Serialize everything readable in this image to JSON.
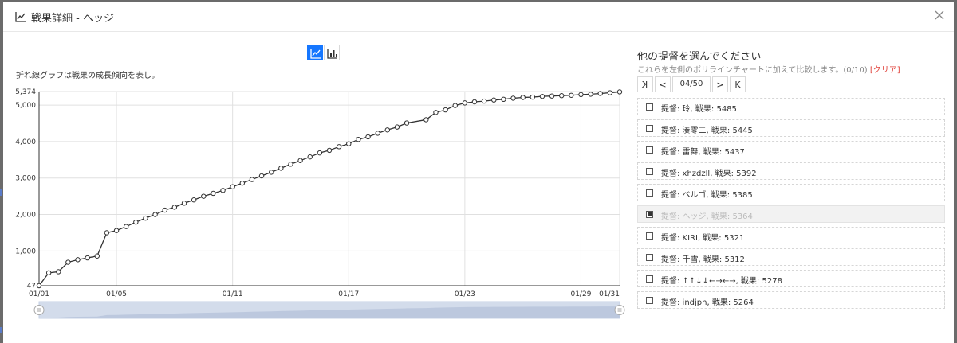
{
  "title": "戦果詳細 - ヘッジ",
  "chart_caption": "折れ線グラフは戦果の成長傾向を表し。",
  "right_panel": {
    "title": "他の提督を選んでください",
    "subtitle": "これらを左側のポリラインチャートに加えて比較します。(0/10)",
    "clear_label": "[クリア]",
    "pager": {
      "first": "K",
      "prev": "<",
      "page": "04/50",
      "next": ">",
      "last": "K"
    },
    "items": [
      {
        "label": "提督: 玲, 戦果: 5485",
        "checked": false,
        "disabled": false
      },
      {
        "label": "提督: 湊零二, 戦果: 5445",
        "checked": false,
        "disabled": false
      },
      {
        "label": "提督: 雷舞, 戦果: 5437",
        "checked": false,
        "disabled": false
      },
      {
        "label": "提督: xhzdzll, 戦果: 5392",
        "checked": false,
        "disabled": false
      },
      {
        "label": "提督: ベルゴ, 戦果: 5385",
        "checked": false,
        "disabled": false
      },
      {
        "label": "提督: ヘッジ, 戦果: 5364",
        "checked": true,
        "disabled": true
      },
      {
        "label": "提督: KIRI, 戦果: 5321",
        "checked": false,
        "disabled": false
      },
      {
        "label": "提督: 千雪, 戦果: 5312",
        "checked": false,
        "disabled": false
      },
      {
        "label": "提督: ↑↑↓↓←→←→, 戦果: 5278",
        "checked": false,
        "disabled": false
      },
      {
        "label": "提督: indjpn, 戦果: 5264",
        "checked": false,
        "disabled": false
      }
    ]
  },
  "colors": {
    "accent": "#1677ff",
    "line": "#333333",
    "grid": "#e0e0e0",
    "clear": "#e0413a",
    "zoom": "#d3dceb"
  },
  "chart_data": {
    "type": "line",
    "ylim": [
      47,
      5374
    ],
    "yticks": [
      "47",
      "1,000",
      "2,000",
      "3,000",
      "4,000",
      "5,000",
      "5,374"
    ],
    "ytick_values": [
      47,
      1000,
      2000,
      3000,
      4000,
      5000,
      5374
    ],
    "xtick_labels": [
      "01/01",
      "01/05",
      "01/11",
      "01/17",
      "01/23",
      "01/29",
      "01/31"
    ],
    "xtick_values": [
      0,
      4,
      10,
      16,
      22,
      28,
      30
    ],
    "x": [
      0,
      0.5,
      1,
      1.5,
      2,
      2.5,
      3,
      3.5,
      4,
      4.5,
      5,
      5.5,
      6,
      6.5,
      7,
      7.5,
      8,
      8.5,
      9,
      9.5,
      10,
      10.5,
      11,
      11.5,
      12,
      12.5,
      13,
      13.5,
      14,
      14.5,
      15,
      15.5,
      16,
      16.5,
      17,
      17.5,
      18,
      18.5,
      19,
      20,
      20.5,
      21,
      21.5,
      22,
      22.5,
      23,
      23.5,
      24,
      24.5,
      25,
      25.5,
      26,
      26.5,
      27,
      27.5,
      28,
      28.5,
      29,
      29.5,
      30
    ],
    "y": [
      47,
      400,
      430,
      690,
      760,
      810,
      860,
      1500,
      1560,
      1670,
      1790,
      1900,
      2000,
      2120,
      2200,
      2310,
      2400,
      2500,
      2580,
      2660,
      2760,
      2860,
      2960,
      3060,
      3160,
      3270,
      3380,
      3480,
      3580,
      3690,
      3760,
      3860,
      3940,
      4060,
      4130,
      4230,
      4320,
      4400,
      4510,
      4600,
      4800,
      4870,
      4990,
      5060,
      5090,
      5110,
      5140,
      5160,
      5190,
      5210,
      5220,
      5240,
      5250,
      5260,
      5270,
      5290,
      5300,
      5320,
      5340,
      5364
    ]
  }
}
